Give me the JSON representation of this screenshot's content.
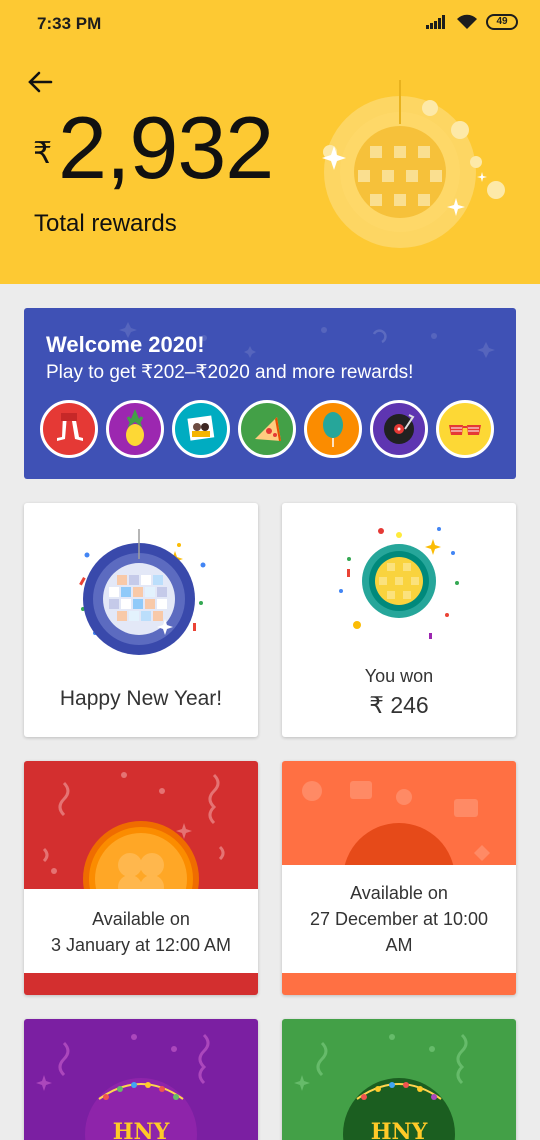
{
  "status_bar": {
    "time": "7:33 PM",
    "battery": "49",
    "icons": [
      "signal-icon",
      "wifi-icon",
      "battery-icon"
    ]
  },
  "header": {
    "back_icon": "back-arrow-icon",
    "currency_symbol": "₹",
    "total_amount": "2,932",
    "total_label": "Total rewards",
    "background_color": "#fdc933"
  },
  "promo": {
    "title": "Welcome 2020!",
    "subtitle": "Play to get ₹202–₹2020 and more rewards!",
    "background_color": "#3f51b5",
    "icons": [
      {
        "name": "dance-legs-icon",
        "color": "#e53935"
      },
      {
        "name": "pineapple-icon",
        "color": "#9c27b0"
      },
      {
        "name": "selfie-photo-icon",
        "color": "#00acc1"
      },
      {
        "name": "pizza-icon",
        "color": "#43a047"
      },
      {
        "name": "balloon-icon",
        "color": "#fb8c00"
      },
      {
        "name": "vinyl-record-icon",
        "color": "#5e35b1"
      },
      {
        "name": "party-glasses-icon",
        "color": "#fdd835"
      }
    ]
  },
  "cards": {
    "happy_new_year": {
      "label": "Happy New Year!"
    },
    "you_won": {
      "label": "You won",
      "amount": "₹ 246"
    },
    "locked_red": {
      "line1": "Available on",
      "line2": "3 January at 12:00 AM",
      "color": "#d32f2f"
    },
    "locked_orange": {
      "line1": "Available on",
      "line2": "27 December at 10:00",
      "line3": "AM",
      "color": "#ff7043"
    },
    "hny_purple": {
      "badge": "HNY",
      "color": "#7b1fa2"
    },
    "hny_green": {
      "badge": "HNY",
      "color": "#43a047"
    }
  }
}
